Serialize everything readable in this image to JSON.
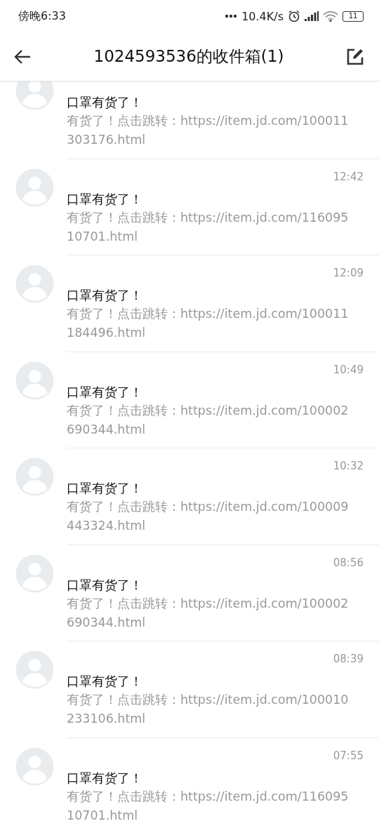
{
  "status_bar": {
    "time": "傍晚6:33",
    "speed": "10.4K/s",
    "battery": "11"
  },
  "header": {
    "title": "1024593536的收件箱(1)"
  },
  "messages": [
    {
      "title": "口罩有货了！",
      "preview": "有货了！点击跳转：https://item.jd.com/100011303176.html"
    },
    {
      "time": "12:42",
      "title": "口罩有货了！",
      "preview": "有货了！点击跳转：https://item.jd.com/11609510701.html"
    },
    {
      "time": "12:09",
      "title": "口罩有货了！",
      "preview": "有货了！点击跳转：https://item.jd.com/100011184496.html"
    },
    {
      "time": "10:49",
      "title": "口罩有货了！",
      "preview": "有货了！点击跳转：https://item.jd.com/100002690344.html"
    },
    {
      "time": "10:32",
      "title": "口罩有货了！",
      "preview": "有货了！点击跳转：https://item.jd.com/100009443324.html"
    },
    {
      "time": "08:56",
      "title": "口罩有货了！",
      "preview": "有货了！点击跳转：https://item.jd.com/100002690344.html"
    },
    {
      "time": "08:39",
      "title": "口罩有货了！",
      "preview": "有货了！点击跳转：https://item.jd.com/100010233106.html"
    },
    {
      "time": "07:55",
      "title": "口罩有货了！",
      "preview": "有货了！点击跳转：https://item.jd.com/11609510701.html"
    }
  ]
}
